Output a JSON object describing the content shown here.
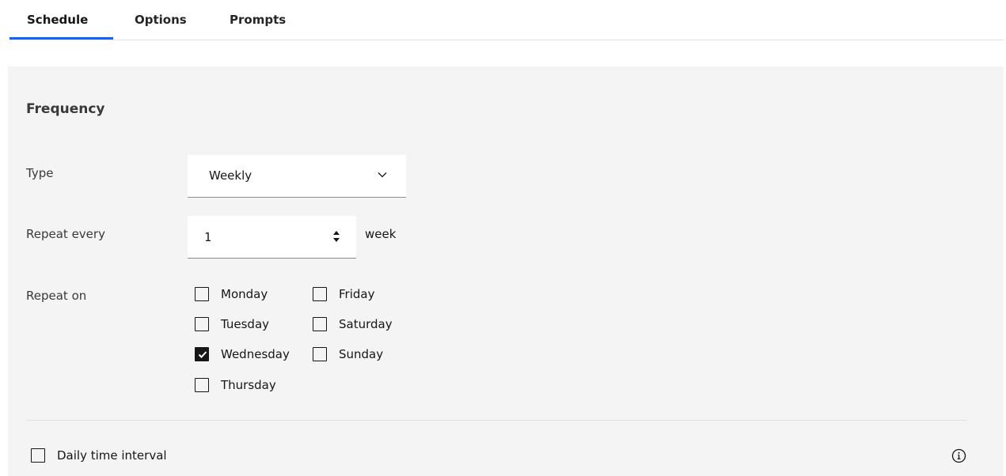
{
  "tabs": [
    {
      "label": "Schedule",
      "active": true
    },
    {
      "label": "Options",
      "active": false
    },
    {
      "label": "Prompts",
      "active": false
    }
  ],
  "frequency": {
    "title": "Frequency",
    "type": {
      "label": "Type",
      "value": "Weekly"
    },
    "repeat_every": {
      "label": "Repeat every",
      "value": "1",
      "unit": "week"
    },
    "repeat_on": {
      "label": "Repeat on",
      "days": [
        {
          "label": "Monday",
          "checked": false
        },
        {
          "label": "Tuesday",
          "checked": false
        },
        {
          "label": "Wednesday",
          "checked": true
        },
        {
          "label": "Thursday",
          "checked": false
        },
        {
          "label": "Friday",
          "checked": false
        },
        {
          "label": "Saturday",
          "checked": false
        },
        {
          "label": "Sunday",
          "checked": false
        }
      ]
    }
  },
  "daily_interval": {
    "label": "Daily time interval",
    "checked": false
  },
  "colors": {
    "accent": "#0f62fe",
    "panel_bg": "#f4f4f4",
    "checkbox_checked": "#161616"
  },
  "icons": {
    "select": "chevron-down-icon",
    "stepper": "stepper-icon",
    "info": "info-icon",
    "check": "checkmark-icon"
  }
}
